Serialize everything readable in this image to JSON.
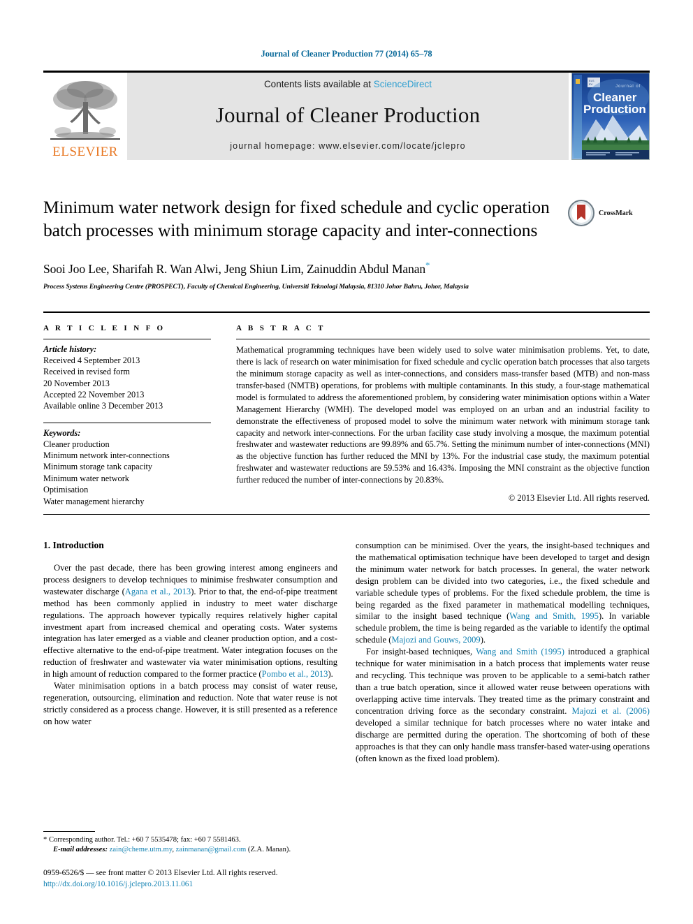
{
  "running_head": "Journal of Cleaner Production 77 (2014) 65–78",
  "masthead": {
    "publisher_name": "ELSEVIER",
    "contents_prefix": "Contents lists available at ",
    "contents_link": "ScienceDirect",
    "journal_title": "Journal of Cleaner Production",
    "homepage": "journal homepage: www.elsevier.com/locate/jclepro",
    "cover_line1": "Journal of",
    "cover_line2": "Cleaner",
    "cover_line3": "Production"
  },
  "article": {
    "title": "Minimum water network design for fixed schedule and cyclic operation batch processes with minimum storage capacity and inter-connections",
    "authors": "Sooi Joo Lee, Sharifah R. Wan Alwi, Jeng Shiun Lim, Zainuddin Abdul Manan",
    "author_star": "*",
    "affiliation": "Process Systems Engineering Centre (PROSPECT), Faculty of Chemical Engineering, Universiti Teknologi Malaysia, 81310 Johor Bahru, Johor, Malaysia",
    "crossmark_label": "CrossMark"
  },
  "info": {
    "heading": "A R T I C L E   I N F O",
    "history_label": "Article history:",
    "history": [
      "Received 4 September 2013",
      "Received in revised form",
      "20 November 2013",
      "Accepted 22 November 2013",
      "Available online 3 December 2013"
    ],
    "keywords_label": "Keywords:",
    "keywords": [
      "Cleaner production",
      "Minimum network inter-connections",
      "Minimum storage tank capacity",
      "Minimum water network",
      "Optimisation",
      "Water management hierarchy"
    ]
  },
  "abstract": {
    "heading": "A B S T R A C T",
    "text": "Mathematical programming techniques have been widely used to solve water minimisation problems. Yet, to date, there is lack of research on water minimisation for fixed schedule and cyclic operation batch processes that also targets the minimum storage capacity as well as inter-connections, and considers mass-transfer based (MTB) and non-mass transfer-based (NMTB) operations, for problems with multiple contaminants. In this study, a four-stage mathematical model is formulated to address the aforementioned problem, by considering water minimisation options within a Water Management Hierarchy (WMH). The developed model was employed on an urban and an industrial facility to demonstrate the effectiveness of proposed model to solve the minimum water network with minimum storage tank capacity and network inter-connections. For the urban facility case study involving a mosque, the maximum potential freshwater and wastewater reductions are 99.89% and 65.7%. Setting the minimum number of inter-connections (MNI) as the objective function has further reduced the MNI by 13%. For the industrial case study, the maximum potential freshwater and wastewater reductions are 59.53% and 16.43%. Imposing the MNI constraint as the objective function further reduced the number of inter-connections by 20.83%.",
    "copyright": "© 2013 Elsevier Ltd. All rights reserved."
  },
  "introduction": {
    "heading": "1. Introduction",
    "left_paragraphs": [
      {
        "segments": [
          {
            "t": "Over the past decade, there has been growing interest among engineers and process designers to develop techniques to minimise freshwater consumption and wastewater discharge (",
            "ref": false
          },
          {
            "t": "Agana et al., 2013",
            "ref": true
          },
          {
            "t": "). Prior to that, the end-of-pipe treatment method has been commonly applied in industry to meet water discharge regulations. The approach however typically requires relatively higher capital investment apart from increased chemical and operating costs. Water systems integration has later emerged as a viable and cleaner production option, and a cost-effective alternative to the end-of-pipe treatment. Water integration focuses on the reduction of freshwater and wastewater via water minimisation options, resulting in high amount of reduction compared to the former practice (",
            "ref": false
          },
          {
            "t": "Pombo et al., 2013",
            "ref": true
          },
          {
            "t": ").",
            "ref": false
          }
        ]
      },
      {
        "segments": [
          {
            "t": "Water minimisation options in a batch process may consist of water reuse, regeneration, outsourcing, elimination and reduction. Note that water reuse is not strictly considered as a process change. However, it is still presented as a reference on how water",
            "ref": false
          }
        ]
      }
    ],
    "right_paragraphs": [
      {
        "indent": false,
        "segments": [
          {
            "t": "consumption can be minimised. Over the years, the insight-based techniques and the mathematical optimisation technique have been developed to target and design the minimum water network for batch processes. In general, the water network design problem can be divided into two categories, i.e., the fixed schedule and variable schedule types of problems. For the fixed schedule problem, the time is being regarded as the fixed parameter in mathematical modelling techniques, similar to the insight based technique (",
            "ref": false
          },
          {
            "t": "Wang and Smith, 1995",
            "ref": true
          },
          {
            "t": "). In variable schedule problem, the time is being regarded as the variable to identify the optimal schedule (",
            "ref": false
          },
          {
            "t": "Majozi and Gouws, 2009",
            "ref": true
          },
          {
            "t": ").",
            "ref": false
          }
        ]
      },
      {
        "indent": true,
        "segments": [
          {
            "t": "For insight-based techniques, ",
            "ref": false
          },
          {
            "t": "Wang and Smith (1995)",
            "ref": true
          },
          {
            "t": " introduced a graphical technique for water minimisation in a batch process that implements water reuse and recycling. This technique was proven to be applicable to a semi-batch rather than a true batch operation, since it allowed water reuse between operations with overlapping active time intervals. They treated time as the primary constraint and concentration driving force as the secondary constraint. ",
            "ref": false
          },
          {
            "t": "Majozi et al. (2006)",
            "ref": true
          },
          {
            "t": " developed a similar technique for batch processes where no water intake and discharge are permitted during the operation. The shortcoming of both of these approaches is that they can only handle mass transfer-based water-using operations (often known as the fixed load problem).",
            "ref": false
          }
        ]
      }
    ]
  },
  "footnote": {
    "corresponding": "* Corresponding author. Tel.: +60 7 5535478; fax: +60 7 5581463.",
    "email_label": "E-mail addresses:",
    "email1": "zain@cheme.utm.my",
    "email_sep": ", ",
    "email2": "zainmanan@gmail.com",
    "email_suffix": " (Z.A. Manan).",
    "issn_line": "0959-6526/$ — see front matter © 2013 Elsevier Ltd. All rights reserved.",
    "doi": "http://dx.doi.org/10.1016/j.jclepro.2013.11.061"
  },
  "colors": {
    "link_blue": "#1281b2",
    "sciencedirect_blue": "#2f9fd0",
    "elsevier_orange": "#E87722",
    "masthead_gray": "#e4e4e4"
  }
}
